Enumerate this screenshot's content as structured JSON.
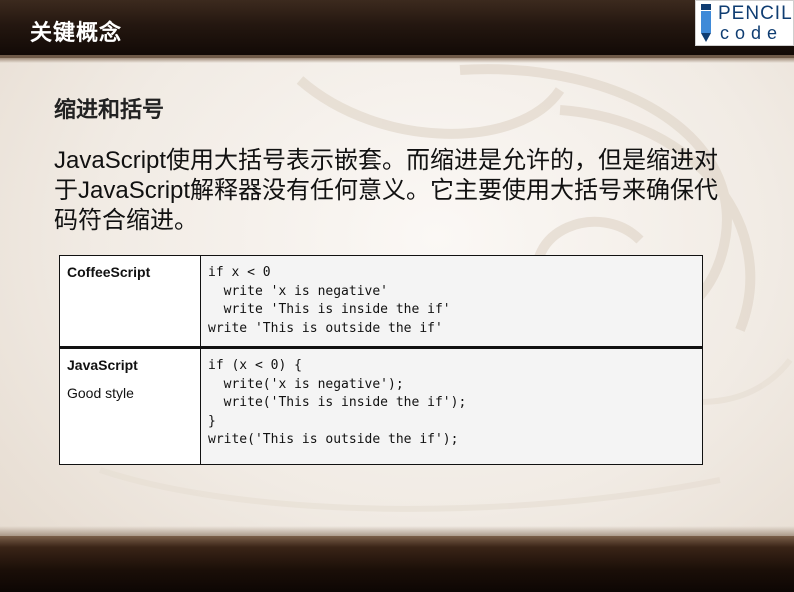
{
  "slide": {
    "title": "关键概念",
    "heading": "缩进和括号",
    "body": "JavaScript使用大括号表示嵌套。而缩进是允许的，但是缩进对于JavaScript解释器没有任何意义。它主要使用大括号来确保代码符合缩进。"
  },
  "logo": {
    "line1": "PENCIL",
    "line2": "code",
    "icon": "pencil-icon",
    "color": "#0f3d72"
  },
  "table": {
    "rows": [
      {
        "language": "CoffeeScript",
        "note": "",
        "code": [
          "if x < 0",
          "  write 'x is negative'",
          "  write 'This is inside the if'",
          "write 'This is outside the if'"
        ]
      },
      {
        "language": "JavaScript",
        "note": "Good style",
        "code": [
          "if (x < 0) {",
          "  write('x is negative');",
          "  write('This is inside the if');",
          "}",
          "write('This is outside the if');"
        ]
      }
    ]
  },
  "colors": {
    "bar_dark": "#1b0f08",
    "accent_brown": "#6f5a48",
    "code_bg": "#f4f4f4"
  }
}
